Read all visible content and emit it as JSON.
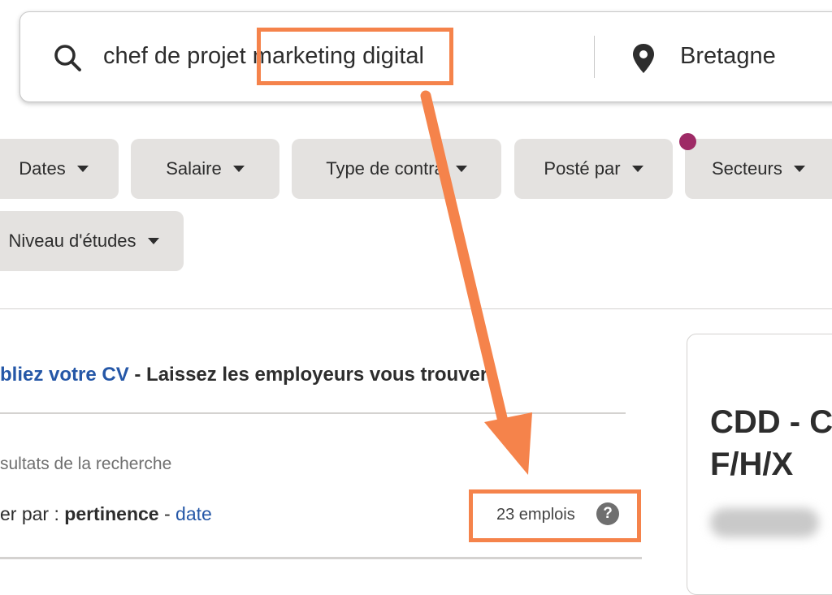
{
  "search": {
    "what": "chef de projet marketing digital",
    "where": "Bretagne"
  },
  "filters": [
    {
      "label": "Dates"
    },
    {
      "label": "Salaire"
    },
    {
      "label": "Type de contra"
    },
    {
      "label": "Posté par"
    },
    {
      "label": "Secteurs"
    },
    {
      "label": "Niveau d'études"
    }
  ],
  "cv_banner": {
    "link": "bliez votre CV",
    "rest": " - Laissez les employeurs vous trouver"
  },
  "results": {
    "label": "sultats de la recherche",
    "sort_prefix": "er par : ",
    "sort_active": "pertinence",
    "sort_sep": " - ",
    "sort_other": "date",
    "count": "23 emplois",
    "help": "?"
  },
  "job_preview": {
    "title": "CDD - C\nF/H/X"
  },
  "colors": {
    "highlight": "#f5834b",
    "link": "#2557a7",
    "chip_bg": "#e4e2e0",
    "badge": "#9e2a66"
  }
}
